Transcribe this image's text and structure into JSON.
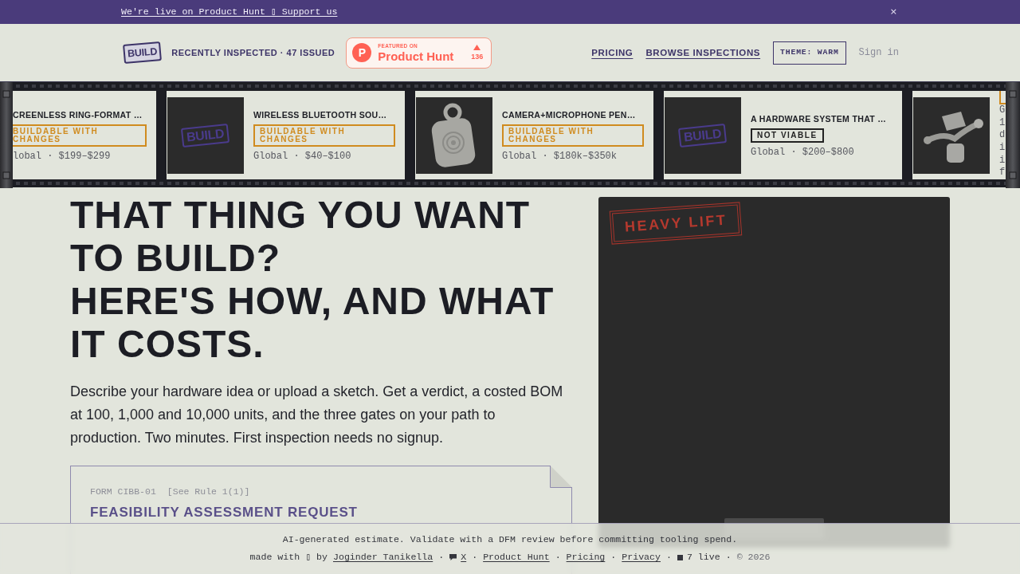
{
  "announcement": {
    "link": "We're live on Product Hunt ▯ Support us",
    "close": "×"
  },
  "header": {
    "logo": "BUILD",
    "stats": "RECENTLY INSPECTED · 47 ISSUED",
    "product_hunt": {
      "logo_letter": "P",
      "kicker": "FEATURED ON",
      "name": "Product Hunt",
      "votes": "136"
    },
    "nav": [
      {
        "label": "PRICING"
      },
      {
        "label": "BROWSE INSPECTIONS"
      }
    ],
    "theme_button": "THEME: WARM",
    "sign_in": "Sign in"
  },
  "film_strip": {
    "cards": [
      {
        "kind": "clipped_left",
        "title": "CREENLESS RING-FORMAT …",
        "badge": {
          "text": "BUILDABLE WITH CHANGES",
          "color": "#d08b1f"
        },
        "meta": "lobal · $199–$299"
      },
      {
        "kind": "full",
        "image": {
          "kind": "logo",
          "text": "BUILD"
        },
        "title": "WIRELESS BLUETOOTH SOU…",
        "badge": {
          "text": "BUILDABLE WITH CHANGES",
          "color": "#d08b1f"
        },
        "meta": "Global · $40–$100"
      },
      {
        "kind": "full",
        "image": {
          "kind": "pendant"
        },
        "title": "CAMERA+MICROPHONE PEN…",
        "badge": {
          "text": "BUILDABLE WITH CHANGES",
          "color": "#d08b1f"
        },
        "meta": "Global · $180k–$350k"
      },
      {
        "kind": "full",
        "image": {
          "kind": "logo",
          "text": "BUILD"
        },
        "title": "A HARDWARE SYSTEM THAT …",
        "badge": {
          "text": "NOT VIABLE",
          "color": "#222222"
        },
        "meta": "Global · $200–$800"
      },
      {
        "kind": "clipped_right",
        "image": {
          "kind": "device"
        },
        "badge": {
          "color": "#d08b1f"
        },
        "meta": "G1diif"
      }
    ]
  },
  "hero": {
    "headline": [
      "THAT THING YOU WANT TO BUILD?",
      "HERE'S HOW, AND WHAT IT COSTS."
    ],
    "intro": "Describe your hardware idea or upload a sketch. Get a verdict, a costed BOM at 100, 1,000 and 10,000 units, and the three gates on your path to production. Two minutes. First inspection needs no signup.",
    "form": {
      "code": "FORM CIBB-01",
      "rule_ref": "[See Rule 1(1)]",
      "title": "FEASIBILITY ASSESSMENT REQUEST"
    }
  },
  "viewer": {
    "stamp": "HEAVY LIFT"
  },
  "footer": {
    "disclaimer": "AI-generated estimate. Validate with a DFM review before committing tooling spend.",
    "credit": {
      "prefix": "made with ▯ by",
      "author": "Joginder Tanikella"
    },
    "separator": "·",
    "links": [
      {
        "kind": "social",
        "text": "X"
      },
      {
        "kind": "link",
        "text": "Product Hunt"
      },
      {
        "kind": "link",
        "text": "Pricing"
      },
      {
        "kind": "link",
        "text": "Privacy"
      },
      {
        "kind": "status",
        "text": "7 live"
      },
      {
        "kind": "text",
        "text": "© 2026"
      }
    ]
  }
}
